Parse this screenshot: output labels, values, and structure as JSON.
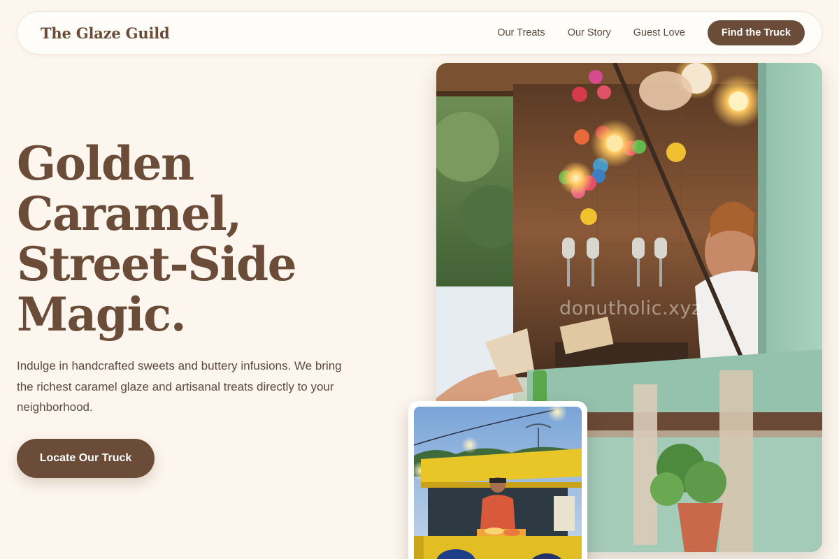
{
  "nav": {
    "brand": "The Glaze Guild",
    "links": [
      "Our Treats",
      "Our Story",
      "Guest Love"
    ],
    "cta": "Find the Truck"
  },
  "hero": {
    "title_lines": [
      "Golden",
      "Caramel,",
      "Street-Side",
      "Magic."
    ],
    "description": "Indulge in handcrafted sweets and buttery infusions. We bring the richest caramel glaze and artisanal treats directly to your neighborhood.",
    "cta": "Locate Our Truck"
  },
  "images": {
    "main_photo_watermark": "donutholic.xyz"
  },
  "colors": {
    "background": "#fdf6ee",
    "brand_brown": "#6b4c38",
    "text": "#5d4a3e",
    "truck_mint": "#9fc9b5"
  }
}
